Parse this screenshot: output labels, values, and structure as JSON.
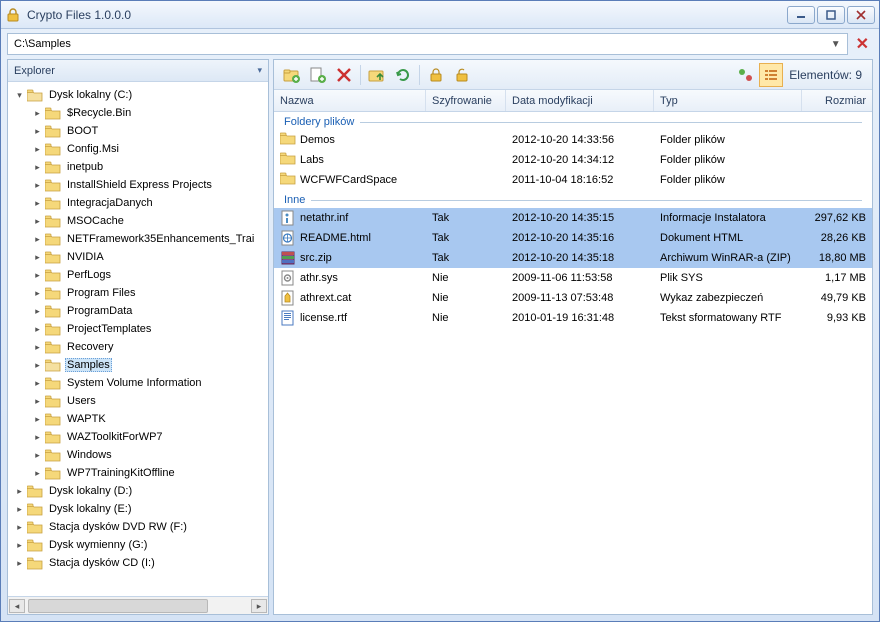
{
  "app": {
    "title": "Crypto Files 1.0.0.0"
  },
  "address": {
    "path": "C:\\Samples"
  },
  "explorer": {
    "title": "Explorer",
    "drives": [
      {
        "label": "Dysk lokalny (C:)",
        "expanded": true,
        "children": [
          "$Recycle.Bin",
          "BOOT",
          "Config.Msi",
          "inetpub",
          "InstallShield Express Projects",
          "IntegracjaDanych",
          "MSOCache",
          "NETFramework35Enhancements_Trai",
          "NVIDIA",
          "PerfLogs",
          "Program Files",
          "ProgramData",
          "ProjectTemplates",
          "Recovery",
          "Samples",
          "System Volume Information",
          "Users",
          "WAPTK",
          "WAZToolkitForWP7",
          "Windows",
          "WP7TrainingKitOffline"
        ],
        "selected": "Samples"
      },
      {
        "label": "Dysk lokalny (D:)"
      },
      {
        "label": "Dysk lokalny (E:)"
      },
      {
        "label": "Stacja dysków DVD RW (F:)"
      },
      {
        "label": "Dysk wymienny (G:)"
      },
      {
        "label": "Stacja dysków CD (I:)"
      }
    ]
  },
  "toolbar": {
    "elements_label": "Elementów: 9"
  },
  "columns": {
    "name": "Nazwa",
    "enc": "Szyfrowanie",
    "date": "Data modyfikacji",
    "type": "Typ",
    "size": "Rozmiar"
  },
  "groups": {
    "folders": {
      "title": "Foldery plików",
      "rows": [
        {
          "name": "Demos",
          "enc": "",
          "date": "2012-10-20 14:33:56",
          "type": "Folder plików",
          "size": "",
          "icon": "folder"
        },
        {
          "name": "Labs",
          "enc": "",
          "date": "2012-10-20 14:34:12",
          "type": "Folder plików",
          "size": "",
          "icon": "folder"
        },
        {
          "name": "WCFWFCardSpace",
          "enc": "",
          "date": "2011-10-04 18:16:52",
          "type": "Folder plików",
          "size": "",
          "icon": "folder"
        }
      ]
    },
    "other": {
      "title": "Inne",
      "rows": [
        {
          "name": "netathr.inf",
          "enc": "Tak",
          "date": "2012-10-20 14:35:15",
          "type": "Informacje Instalatora",
          "size": "297,62 KB",
          "icon": "inf",
          "sel": true
        },
        {
          "name": "README.html",
          "enc": "Tak",
          "date": "2012-10-20 14:35:16",
          "type": "Dokument HTML",
          "size": "28,26 KB",
          "icon": "html",
          "sel": true
        },
        {
          "name": "src.zip",
          "enc": "Tak",
          "date": "2012-10-20 14:35:18",
          "type": "Archiwum WinRAR-a (ZIP)",
          "size": "18,80 MB",
          "icon": "zip",
          "sel": true
        },
        {
          "name": "athr.sys",
          "enc": "Nie",
          "date": "2009-11-06 11:53:58",
          "type": "Plik SYS",
          "size": "1,17 MB",
          "icon": "sys"
        },
        {
          "name": "athrext.cat",
          "enc": "Nie",
          "date": "2009-11-13 07:53:48",
          "type": "Wykaz zabezpieczeń",
          "size": "49,79 KB",
          "icon": "cat"
        },
        {
          "name": "license.rtf",
          "enc": "Nie",
          "date": "2010-01-19 16:31:48",
          "type": "Tekst sformatowany RTF",
          "size": "9,93 KB",
          "icon": "rtf"
        }
      ]
    }
  }
}
